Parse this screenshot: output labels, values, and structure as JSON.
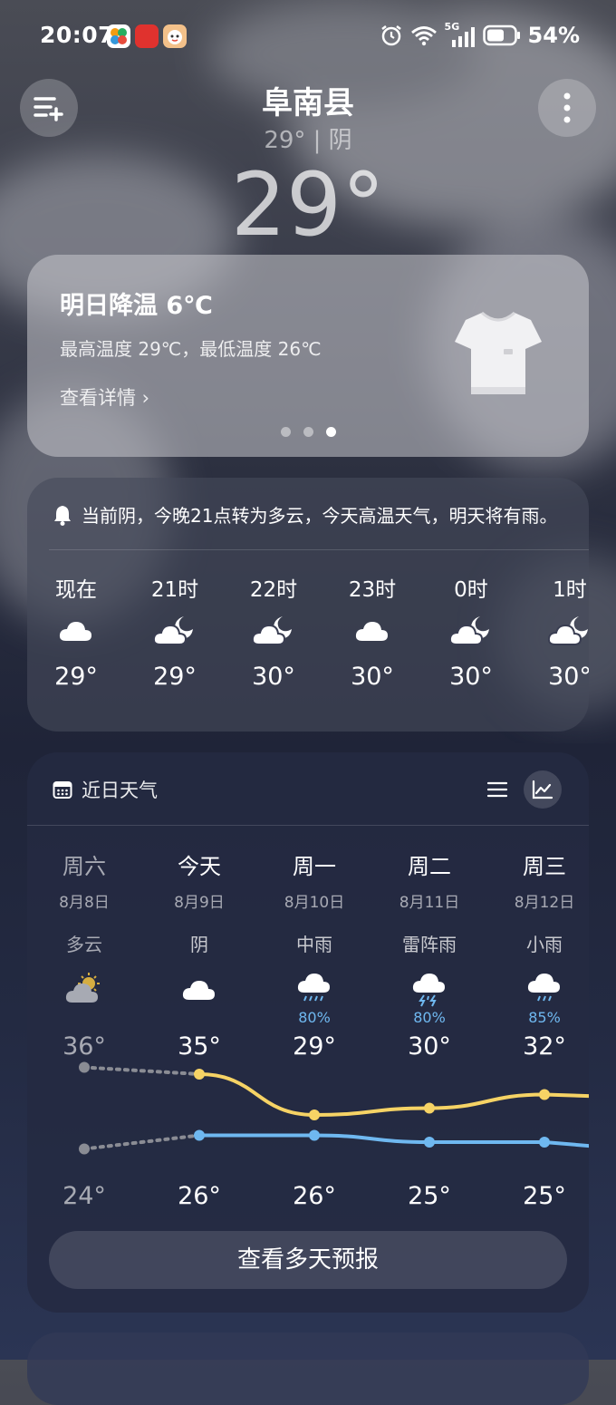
{
  "status_bar": {
    "time": "20:07",
    "battery": "54%",
    "network": "5G"
  },
  "header": {
    "city": "阜南县",
    "subtitle": "29° | 阴",
    "current_temp": "29°"
  },
  "alert_card": {
    "title": "明日降温 6℃",
    "detail": "最高温度 29℃，最低温度 26℃",
    "link": "查看详情 ›",
    "pages": 3,
    "active_page": 3
  },
  "hourly": {
    "notice": "当前阴，今晚21点转为多云，今天高温天气，明天将有雨。",
    "items": [
      {
        "time": "现在",
        "icon": "cloud-icon",
        "temp": "29°"
      },
      {
        "time": "21时",
        "icon": "cloud-moon-icon",
        "temp": "29°"
      },
      {
        "time": "22时",
        "icon": "cloud-moon-icon",
        "temp": "30°"
      },
      {
        "time": "23时",
        "icon": "cloud-icon",
        "temp": "30°"
      },
      {
        "time": "0时",
        "icon": "cloud-moon-icon",
        "temp": "30°"
      },
      {
        "time": "1时",
        "icon": "cloud-moon-icon",
        "temp": "30°"
      }
    ]
  },
  "daily": {
    "title": "近日天气",
    "more_button": "查看多天预报",
    "days": [
      {
        "name": "周六",
        "date": "8月8日",
        "cond": "多云",
        "icon": "partly-sunny-icon",
        "prob": "",
        "high": "36°",
        "low": "24°",
        "past": true
      },
      {
        "name": "今天",
        "date": "8月9日",
        "cond": "阴",
        "icon": "cloud-icon",
        "prob": "",
        "high": "35°",
        "low": "26°",
        "past": false
      },
      {
        "name": "周一",
        "date": "8月10日",
        "cond": "中雨",
        "icon": "rain-icon",
        "prob": "80%",
        "high": "29°",
        "low": "26°",
        "past": false
      },
      {
        "name": "周二",
        "date": "8月11日",
        "cond": "雷阵雨",
        "icon": "thunderstorm-icon",
        "prob": "80%",
        "high": "30°",
        "low": "25°",
        "past": false
      },
      {
        "name": "周三",
        "date": "8月12日",
        "cond": "小雨",
        "icon": "light-rain-icon",
        "prob": "85%",
        "high": "32°",
        "low": "25°",
        "past": false
      }
    ]
  },
  "chart_data": {
    "type": "line",
    "categories": [
      "周六",
      "今天",
      "周一",
      "周二",
      "周三"
    ],
    "series": [
      {
        "values": [
          36,
          35,
          29,
          30,
          32
        ],
        "color": "#f6d365"
      },
      {
        "values": [
          24,
          26,
          26,
          25,
          25
        ],
        "color": "#6fb8f0"
      }
    ],
    "ylim": [
      23,
      37
    ]
  },
  "colors": {
    "high_line": "#f6d365",
    "low_line": "#6fb8f0",
    "past_line": "#8a8c94"
  }
}
